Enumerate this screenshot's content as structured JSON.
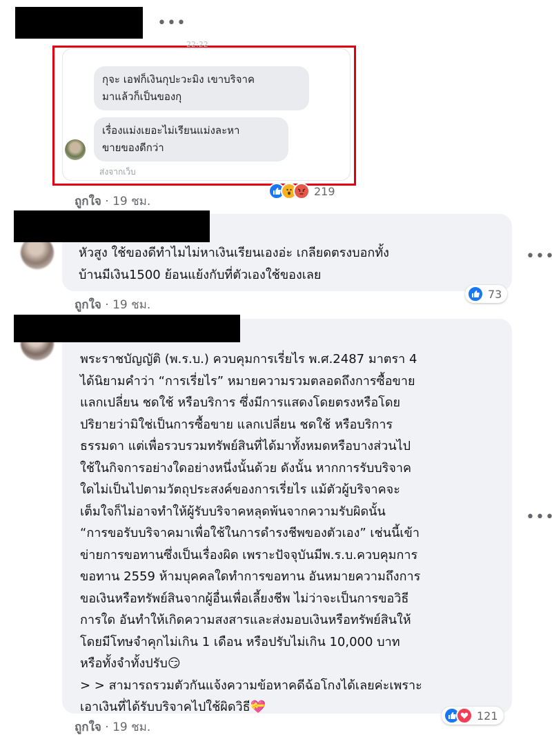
{
  "comments": [
    {
      "author_redacted": true,
      "screenshot": {
        "timestamp": "22:22",
        "messages": [
          "กุจะ เอฟก็เงินกุปะวะมิง เขาบริจาค\nมาแล้วก็เป็นของกุ",
          "เรื่องแม่งเยอะไม่เรียนแม่งละหา\nขายของดีกว่า"
        ],
        "sent_from": "ส่งจากเว็บ"
      },
      "like_label": "ถูกใจ",
      "time": "19 ชม.",
      "reaction_count": "219",
      "reactions": [
        "like-icon",
        "wow-icon",
        "angry-icon"
      ]
    },
    {
      "author_redacted": true,
      "text": "หัวสูง ใช้ของดีทำไมไม่หาเงินเรียนเองอ่ะ เกลียดตรงบอกทั้ง\nบ้านมีเงิน1500 ย้อนแย้งกับที่ตัวเองใช้ของเลย",
      "like_label": "ถูกใจ",
      "time": "19 ชม.",
      "reaction_count": "73",
      "reactions": [
        "like-icon"
      ]
    },
    {
      "author_redacted": true,
      "text": "พระราชบัญญัติ (พ.ร.บ.) ควบคุมการเรี่ยไร พ.ศ.2487 มาตรา 4\nได้นิยามคำว่า “การเรี่ยไร” หมายความรวมตลอดถึงการซื้อขาย\nแลกเปลี่ยน ชดใช้ หรือบริการ ซึ่งมีการแสดงโดยตรงหรือโดย\nปริยายว่ามิใช่เป็นการซื้อขาย แลกเปลี่ยน ชดใช้ หรือบริการ\nธรรมดา แต่เพื่อรวบรวมทรัพย์สินที่ได้มาทั้งหมดหรือบางส่วนไป\nใช้ในกิจการอย่างใดอย่างหนึ่งนั้นด้วย ดังนั้น หากการรับบริจาค\nใดไม่เป็นไปตามวัตถุประสงค์ของการเรี่ยไร แม้ตัวผู้บริจาคจะ\nเต็มใจก็ไม่อาจทำให้ผู้รับบริจาคหลุดพ้นจากความรับผิดนั้น\n“การขอรับบริจาคมาเพื่อใช้ในการดำรงชีพของตัวเอง” เช่นนี้เข้า\nข่ายการขอทานซึ่งเป็นเรื่องผิด เพราะปัจจุบันมีพ.ร.บ.ควบคุมการ\nขอทาน 2559 ห้ามบุคคลใดทำการขอทาน อันหมายความถึงการ\nขอเงินหรือทรัพย์สินจากผู้อื่นเพื่อเลี้ยงชีพ ไม่ว่าจะเป็นการขอวิธี\nการใด อันทำให้เกิดความสงสารและส่งมอบเงินหรือทรัพย์สินให้\nโดยมีโทษจำคุกไม่เกิน 1 เดือน หรือปรับไม่เกิน 10,000 บาท\nหรือทั้งจำทั้งปรับ😏\n> > สามารถรวมตัวกันแจ้งความข้อหาคดีฉ้อโกงได้เลยค่ะเพราะ\nเอาเงินที่ได้รับบริจาคไปใช้ผิดวิธี💝",
      "like_label": "ถูกใจ",
      "time": "19 ชม.",
      "reaction_count": "121",
      "reactions": [
        "like-icon",
        "love-icon"
      ]
    }
  ],
  "separator": "·",
  "more_label": "•••",
  "colors": {
    "bubble": "#f0f2f5",
    "highlight_border": "#e0000f",
    "like": "#1877f2",
    "meta": "#65676b"
  }
}
